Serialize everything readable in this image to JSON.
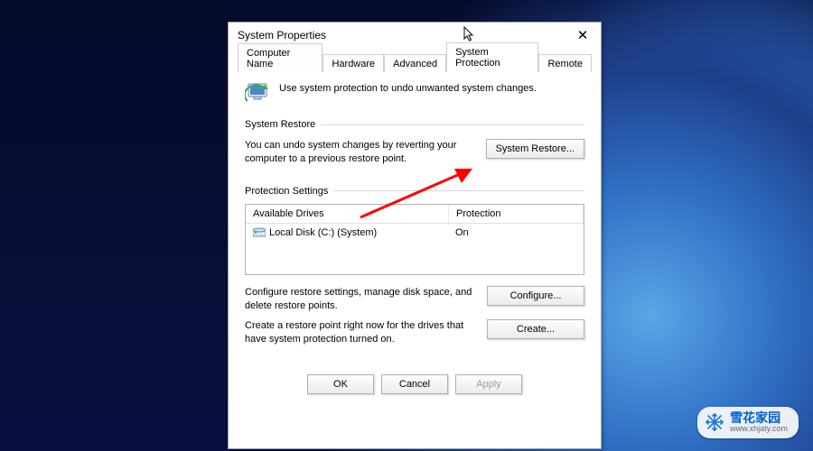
{
  "window": {
    "title": "System Properties"
  },
  "tabs": [
    {
      "label": "Computer Name"
    },
    {
      "label": "Hardware"
    },
    {
      "label": "Advanced"
    },
    {
      "label": "System Protection"
    },
    {
      "label": "Remote"
    }
  ],
  "active_tab_index": 3,
  "intro": "Use system protection to undo unwanted system changes.",
  "groups": {
    "restore": {
      "legend": "System Restore",
      "desc": "You can undo system changes by reverting your computer to a previous restore point.",
      "button": "System Restore..."
    },
    "protection": {
      "legend": "Protection Settings",
      "headers": {
        "drives": "Available Drives",
        "protection": "Protection"
      },
      "rows": [
        {
          "name": "Local Disk (C:) (System)",
          "protection": "On"
        }
      ],
      "configure_desc": "Configure restore settings, manage disk space, and delete restore points.",
      "configure_btn": "Configure...",
      "create_desc": "Create a restore point right now for the drives that have system protection turned on.",
      "create_btn": "Create..."
    }
  },
  "buttons": {
    "ok": "OK",
    "cancel": "Cancel",
    "apply": "Apply"
  },
  "watermark": {
    "main": "雪花家园",
    "sub": "www.xhjaty.com"
  }
}
